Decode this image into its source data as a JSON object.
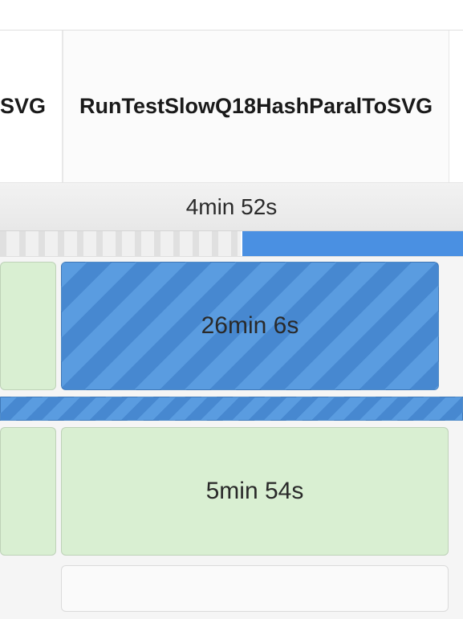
{
  "tabs": {
    "partial_left": "SVG",
    "active": "RunTestSlowQ18HashParalToSVG"
  },
  "subheader": {
    "duration": "4min 52s"
  },
  "rows": [
    {
      "duration": "26min 6s"
    },
    {
      "duration": "5min 54s"
    }
  ]
}
